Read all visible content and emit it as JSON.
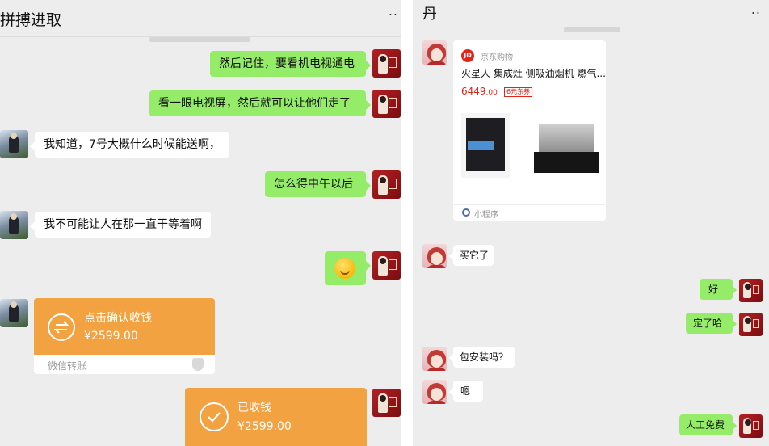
{
  "left": {
    "title": "拼搏进取",
    "more": "..",
    "messages": [
      {
        "from": "me",
        "text": "然后记住，要看机电视通电"
      },
      {
        "from": "me",
        "text": "看一眼电视屏，然后就可以让他们走了"
      },
      {
        "from": "them",
        "text": "我知道，7号大概什么时候能送啊，"
      },
      {
        "from": "me",
        "text": "怎么得中午以后"
      },
      {
        "from": "them",
        "text": "我不可能让人在那一直干等着啊"
      },
      {
        "from": "me",
        "emoji": "smirk-emoji"
      }
    ],
    "transfer_pending": {
      "label": "点击确认收钱",
      "amount": "¥2599.00",
      "footer": "微信转账"
    },
    "transfer_received": {
      "label": "已收钱",
      "amount": "¥2599.00"
    }
  },
  "right": {
    "title": "丹",
    "more": "..",
    "card": {
      "shop": "京东购物",
      "product_name": "火星人 集成灶 侧吸油烟机 燃气...",
      "price_main": "6449",
      "price_decimal": ".00",
      "coupon": "6元东券",
      "mini_program": "小程序"
    },
    "messages": [
      {
        "from": "her",
        "text": "买它了"
      },
      {
        "from": "me",
        "text": "好"
      },
      {
        "from": "me",
        "text": "定了哈"
      },
      {
        "from": "her",
        "text": "包安装吗？"
      },
      {
        "from": "her",
        "text": "嗯"
      },
      {
        "from": "me",
        "text": "人工免费"
      }
    ]
  },
  "colors": {
    "bubble_out": "#95ec69",
    "bubble_in": "#ffffff",
    "transfer": "#f3a242",
    "jd_red": "#e1251b",
    "bg": "#ededed"
  }
}
